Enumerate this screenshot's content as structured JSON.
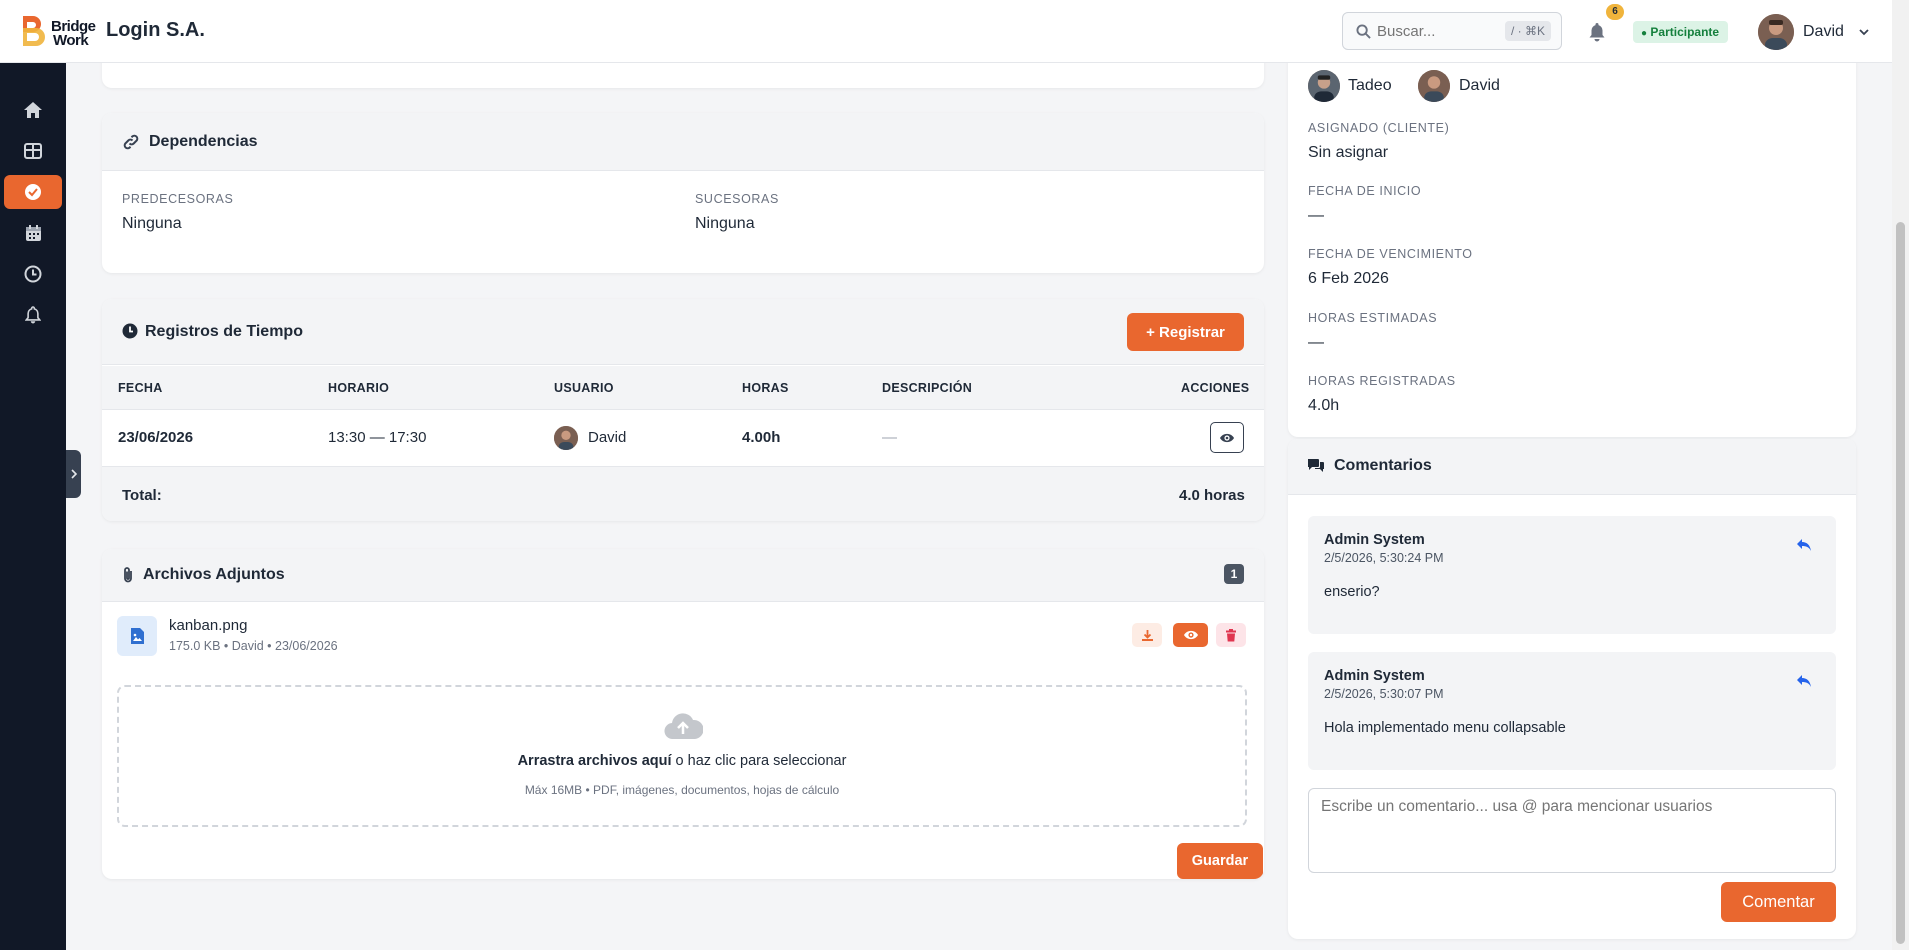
{
  "brand": {
    "logo_line1": "Bridge",
    "logo_line2": "Work",
    "org_name": "Login S.A.",
    "accent": "#e9672f"
  },
  "header": {
    "search_placeholder": "Buscar...",
    "search_shortcut": "/ · ⌘K",
    "notifications_count": "6",
    "role_badge": "Participante",
    "user_name": "David"
  },
  "sidebar": {
    "items": [
      "home-icon",
      "dashboard-icon",
      "tasks-check-icon",
      "calendar-icon",
      "clock-icon",
      "bell-icon"
    ],
    "active_index": 2
  },
  "dependencies": {
    "title": "Dependencias",
    "predecessors_label": "PREDECESORAS",
    "predecessors_value": "Ninguna",
    "successors_label": "SUCESORAS",
    "successors_value": "Ninguna"
  },
  "time_logs": {
    "title": "Registros de Tiempo",
    "register_button": "+ Registrar",
    "columns": [
      "FECHA",
      "HORARIO",
      "USUARIO",
      "HORAS",
      "DESCRIPCIÓN",
      "ACCIONES"
    ],
    "rows": [
      {
        "date": "23/06/2026",
        "schedule": "13:30 — 17:30",
        "user": "David",
        "hours": "4.00h",
        "description": "—"
      }
    ],
    "total_label": "Total:",
    "total_value": "4.0 horas"
  },
  "attachments": {
    "title": "Archivos Adjuntos",
    "count": "1",
    "files": [
      {
        "name": "kanban.png",
        "meta": "175.0 KB • David • 23/06/2026"
      }
    ],
    "drop_bold": "Arrastra archivos aquí",
    "drop_rest": " o haz clic para seleccionar",
    "drop_hint": "Máx 16MB • PDF, imágenes, documentos, hojas de cálculo",
    "save_button": "Guardar"
  },
  "details": {
    "assignees": [
      "Tadeo",
      "David"
    ],
    "fields": [
      {
        "label": "ASIGNADO (CLIENTE)",
        "value": "Sin asignar"
      },
      {
        "label": "FECHA DE INICIO",
        "value": "—"
      },
      {
        "label": "FECHA DE VENCIMIENTO",
        "value": "6 Feb 2026"
      },
      {
        "label": "HORAS ESTIMADAS",
        "value": "—"
      },
      {
        "label": "HORAS REGISTRADAS",
        "value": "4.0h"
      }
    ]
  },
  "comments": {
    "title": "Comentarios",
    "items": [
      {
        "author": "Admin System",
        "time": "2/5/2026, 5:30:24 PM",
        "body": "enserio?"
      },
      {
        "author": "Admin System",
        "time": "2/5/2026, 5:30:07 PM",
        "body": "Hola implementado menu collapsable"
      }
    ],
    "input_placeholder": "Escribe un comentario... usa @ para mencionar usuarios",
    "submit_button": "Comentar"
  }
}
